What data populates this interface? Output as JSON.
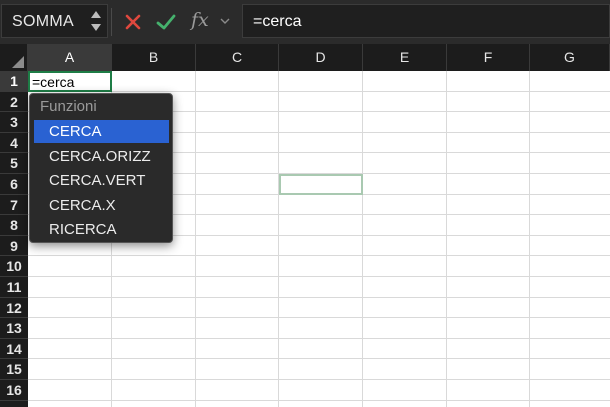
{
  "formula_bar": {
    "name_box": "SOMMA",
    "fx_label": "fx",
    "formula": "=cerca"
  },
  "columns": [
    "A",
    "B",
    "C",
    "D",
    "E",
    "F",
    "G"
  ],
  "rows": [
    "1",
    "2",
    "3",
    "4",
    "5",
    "6",
    "7",
    "8",
    "9",
    "10",
    "11",
    "12",
    "13",
    "14",
    "15",
    "16"
  ],
  "active_cell": {
    "ref": "A1",
    "value": "=cerca"
  },
  "selected_range": "D6",
  "autocomplete": {
    "header": "Funzioni",
    "items": [
      {
        "label": "CERCA",
        "selected": true
      },
      {
        "label": "CERCA.ORIZZ",
        "selected": false
      },
      {
        "label": "CERCA.VERT",
        "selected": false
      },
      {
        "label": "CERCA.X",
        "selected": false
      },
      {
        "label": "RICERCA",
        "selected": false
      }
    ]
  },
  "icons": {
    "cancel": "close-icon",
    "accept": "checkmark-icon",
    "fx": "function-icon"
  },
  "colors": {
    "cancel": "#e0483e",
    "accept": "#45b16d",
    "selection": "#2a62d2",
    "active_border": "#1e7d46"
  }
}
